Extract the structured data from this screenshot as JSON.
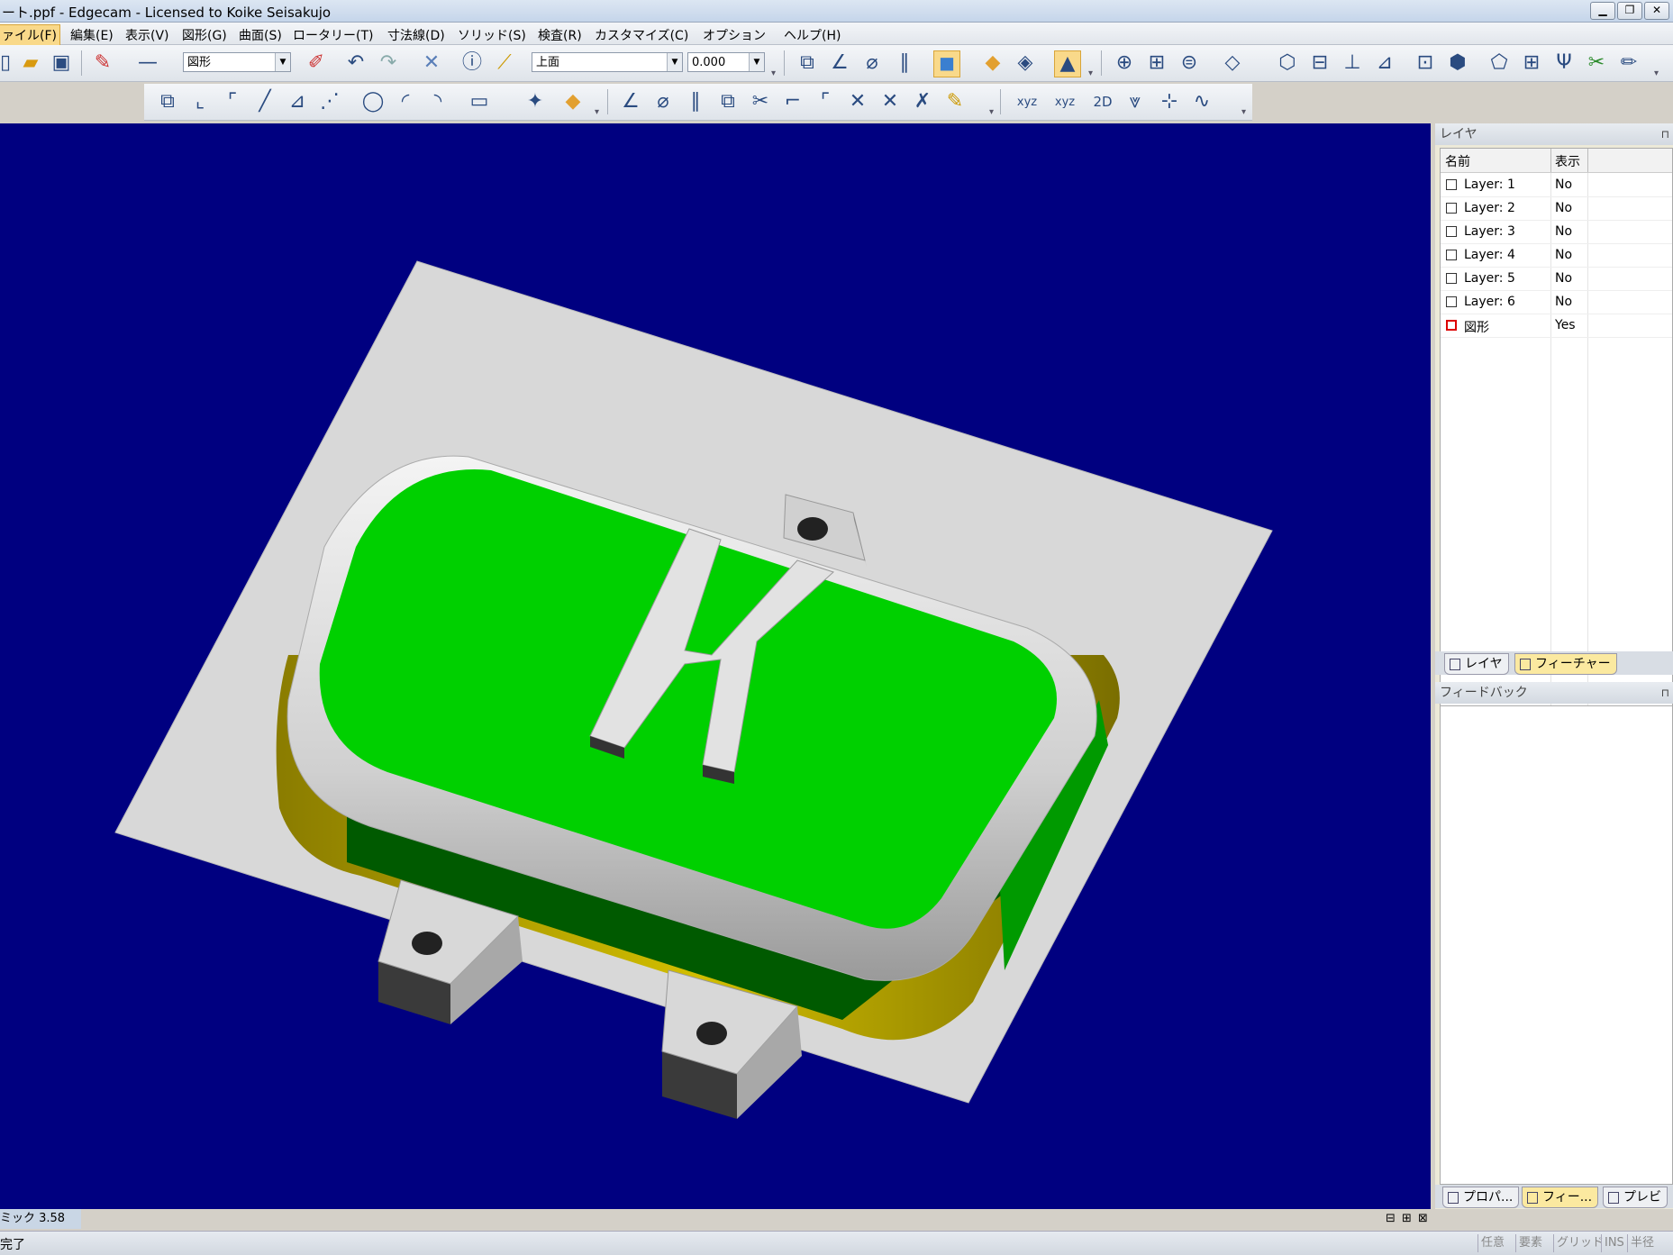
{
  "window": {
    "title": "ート.ppf - Edgecam - Licensed to Koike Seisakujo"
  },
  "menu": [
    {
      "label": "ァイル(F)",
      "active": true
    },
    {
      "label": "編集(E)"
    },
    {
      "label": "表示(V)"
    },
    {
      "label": "図形(G)"
    },
    {
      "label": "曲面(S)"
    },
    {
      "label": "ロータリー(T)"
    },
    {
      "label": "寸法線(D)"
    },
    {
      "label": "ソリッド(S)"
    },
    {
      "label": "検査(R)"
    },
    {
      "label": "カスタマイズ(C)"
    },
    {
      "label": "オプション"
    },
    {
      "label": "ヘルプ(H)"
    }
  ],
  "toolbar": {
    "layer_combo": "図形",
    "view_combo": "上面",
    "depth_value": "0.000",
    "xyz_label1": "xyz",
    "xyz_label2": "xyz",
    "label_2d": "2D"
  },
  "layers_panel": {
    "title": "レイヤ",
    "col_name": "名前",
    "col_visible": "表示",
    "rows": [
      {
        "name": "Layer: 1",
        "visible": "No"
      },
      {
        "name": "Layer: 2",
        "visible": "No"
      },
      {
        "name": "Layer: 3",
        "visible": "No"
      },
      {
        "name": "Layer: 4",
        "visible": "No"
      },
      {
        "name": "Layer: 5",
        "visible": "No"
      },
      {
        "name": "Layer: 6",
        "visible": "No"
      },
      {
        "name": "図形",
        "visible": "Yes",
        "current": true
      }
    ],
    "tabs": [
      "レイヤ",
      "フィーチャー"
    ]
  },
  "feedback_panel": {
    "title": "フィードバック"
  },
  "bottom_tabs": [
    "プロパ...",
    "フィー...",
    "プレビ"
  ],
  "status": {
    "dynamic_label": "ミック 3.58",
    "message": "完了",
    "indicators": [
      "任意",
      "要素",
      "グリッド",
      "INS",
      "半径"
    ]
  },
  "colors": {
    "viewport_bg": "#000080",
    "top_face": "#00d000",
    "side_face": "#007a00",
    "yellow_side": "#c8b400",
    "plate": "#d8d8d8"
  }
}
